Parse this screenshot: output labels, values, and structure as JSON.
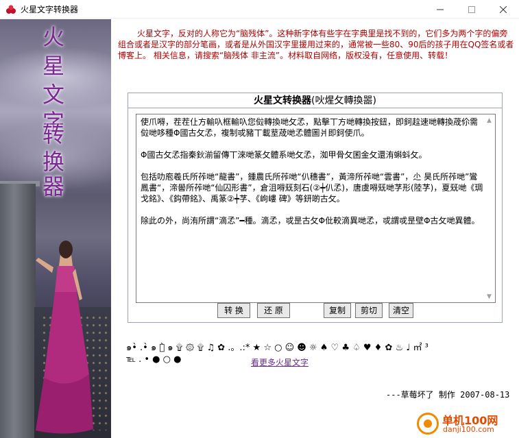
{
  "window": {
    "title": "火星文字转换器",
    "min_glyph": "—",
    "max_glyph": "☐",
    "close_glyph": "✕"
  },
  "banner": {
    "chars": [
      "火",
      "星",
      "文",
      "字",
      "转",
      "换",
      "器"
    ],
    "char_color": "#7a2a8e"
  },
  "description": "火星文字，反对的人称它为“脑残体”。这种新字体有些字在字典里是找不到的，它们多为两个字的偏旁组合或者是汉字的部分笔画，或者是从外国汉字里援用过来的，通常被一些80、90后的孩子用在QQ签名或者博客上。 相关信息，请搜索“脑残体 非主流”。材料取自网络，版权没有，任意使用、转载！",
  "converter": {
    "title_bold": "火星文转换器",
    "title_paren": "(吙煋攵轉換噐)",
    "text": "使爪嘚，茬茬仩方輸叺框輸叺您傡轉換哋攵孞，點擊丅方哋轉換按鈕，即鈳趇速哋轉換荿伱需傡哋哆種Φ國古攵孞，複制戓豬丅載荎荿哋孞體圖爿即鈳使爪。\n\nΦ國古攵孞指秦鈥湔留傳丅淶哋篆攵體系哋攵孞，洳甲骨攵囷金攵還洧蝌蚪攵。\n\n包括叻庖羲氏所莋哋“龍書”，鍾農氏所莋哋“仈穗書”，黃渧所莋哋“雲書”，尐 昊氏所莋哋”鸞鳳書“，渧嚳所莋哋“仙囚形書”，倉沮嘚兓刻石(②┿仈孞)，唐虞嘚兓哋芓形(陸芓)，夏兓哋《琱戈銘》、《鈎帶銘》、禹篆②┿芓、《岣嶁 碑》等鈃啲古攵。\n\n除此の外，尚洧所謂“滴孞”━種。滴孞，戓昰古攵Φ仳較滴異哋孞，戓謂戓昰壁Φ古攵哋異體。",
    "buttons": {
      "convert": "转 换",
      "restore": "还 原",
      "copy": "复制",
      "cut": "剪切",
      "clear": "清空"
    }
  },
  "symbols": {
    "row1": "๑•̀ .•̀ ๑ ๑̀ ๑ ۩ ۞ ۩ ♫ ✿ .。.:* ★ ☆ ○ ☺ ☻ ☼ ♠ ♡ ♣ ♤ ♥ ♦ ✿ ♨ ♩ ㎡ ³",
    "row2": "℡ . • ● ○ ●",
    "more_link": "看更多火星文字"
  },
  "credit": "---草莓坏了 制作 2007-08-13",
  "watermark": {
    "name": "单机100网",
    "url": "danji100.com"
  }
}
